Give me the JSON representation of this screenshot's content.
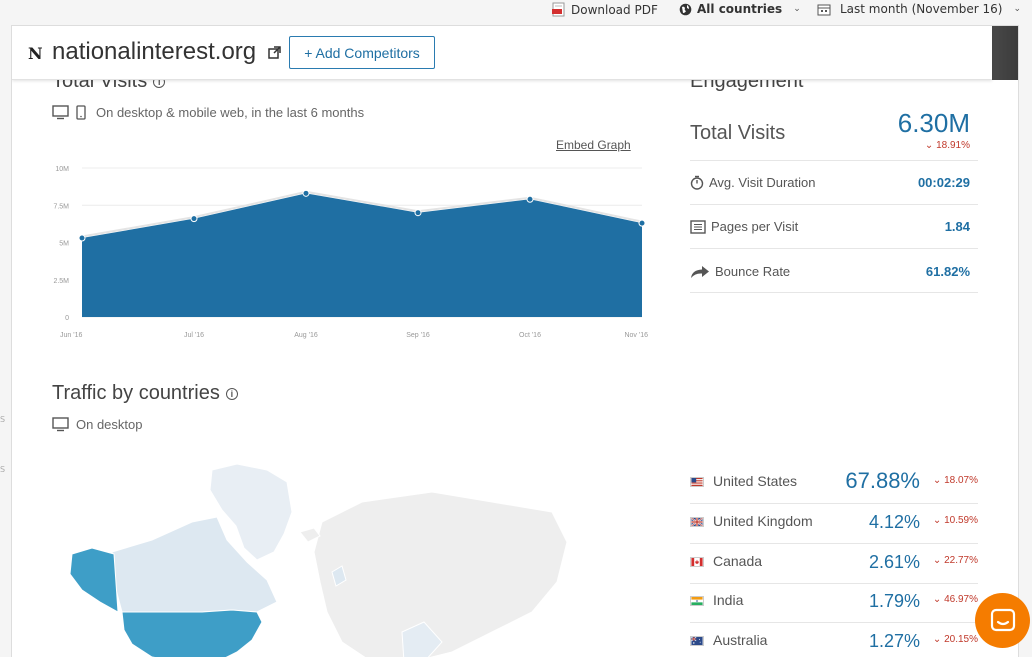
{
  "topbar": {
    "download_pdf": "Download PDF",
    "countries": "All countries",
    "period": "Last month (November 16)"
  },
  "site": {
    "logo_glyph": "N",
    "domain": "nationalinterest.org",
    "add_competitors": "+ Add Competitors"
  },
  "visits": {
    "title": "Total Visits",
    "subtitle": "On desktop & mobile web, in the last 6 months",
    "embed": "Embed Graph"
  },
  "chart_data": {
    "type": "area",
    "x": [
      "Jun '16",
      "Jul '16",
      "Aug '16",
      "Sep '16",
      "Oct '16",
      "Nov '16"
    ],
    "values": [
      5.3,
      6.6,
      8.3,
      7.0,
      7.9,
      6.3
    ],
    "yticks": [
      "0",
      "2.5M",
      "5M",
      "7.5M",
      "10M"
    ],
    "ylim": [
      0,
      10
    ],
    "grid": true,
    "color": "#1f6fa3"
  },
  "engagement": {
    "title": "Engagement",
    "total_visits_label": "Total Visits",
    "total_visits_value": "6.30M",
    "total_visits_change": "18.91%",
    "rows": [
      {
        "label": "Avg. Visit Duration",
        "value": "00:02:29"
      },
      {
        "label": "Pages per Visit",
        "value": "1.84"
      },
      {
        "label": "Bounce Rate",
        "value": "61.82%"
      }
    ]
  },
  "countries": {
    "title": "Traffic by countries",
    "subtitle": "On desktop",
    "rows": [
      {
        "name": "United States",
        "pct": "67.88%",
        "change": "18.07%"
      },
      {
        "name": "United Kingdom",
        "pct": "4.12%",
        "change": "10.59%"
      },
      {
        "name": "Canada",
        "pct": "2.61%",
        "change": "22.77%"
      },
      {
        "name": "India",
        "pct": "1.79%",
        "change": "46.97%"
      },
      {
        "name": "Australia",
        "pct": "1.27%",
        "change": "20.15%"
      }
    ]
  },
  "colors": {
    "accent": "#1f6fa3",
    "negative": "#c0392b",
    "map_highlight": "#3e9ec7",
    "chat": "#f57c00"
  }
}
